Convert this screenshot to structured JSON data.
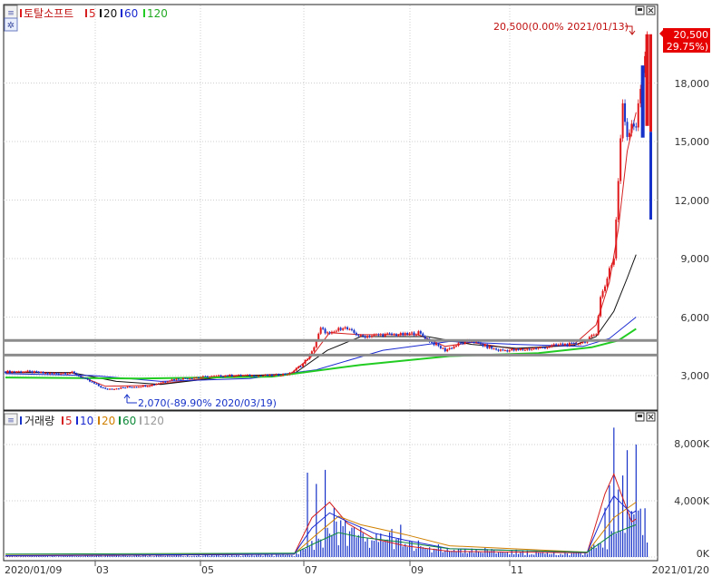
{
  "colors": {
    "up": "#e0181b",
    "down": "#1632c8",
    "ma5": "#d42020",
    "ma20": "#111111",
    "ma60": "#1a2ad0",
    "ma120": "#22cc22",
    "grid": "#cfcfcf",
    "level": "#8c8c8c",
    "vol10": "#1a2ad0",
    "vol20": "#d08000",
    "vol60": "#0f8a3a",
    "vol120": "#aaaaaa",
    "price_box": "#e60000"
  },
  "price_panel": {
    "legend": {
      "name": "토탈소프트",
      "items": [
        {
          "label": "5",
          "color": "#d42020"
        },
        {
          "label": "20",
          "color": "#111111"
        },
        {
          "label": "60",
          "color": "#1a2ad0"
        },
        {
          "label": "120",
          "color": "#22cc22"
        }
      ]
    },
    "high_annotation": "20,500(0.00% 2021/01/13)",
    "low_annotation": "2,070(-89.90% 2020/03/19)",
    "current_price": "20,500",
    "current_change": "( 29.75%)",
    "y_ticks": [
      "18,000",
      "15,000",
      "12,000",
      "9,000",
      "6,000",
      "3,000"
    ]
  },
  "volume_panel": {
    "legend": {
      "name": "거래량",
      "items": [
        {
          "label": "5",
          "color": "#d42020"
        },
        {
          "label": "10",
          "color": "#1a2ad0"
        },
        {
          "label": "20",
          "color": "#d08000"
        },
        {
          "label": "60",
          "color": "#0f8a3a"
        },
        {
          "label": "120",
          "color": "#aaaaaa"
        }
      ]
    },
    "y_ticks": [
      "8,000K",
      "4,000K",
      "0K"
    ]
  },
  "x_axis": {
    "labels": [
      "2020/01/09",
      "03",
      "05",
      "07",
      "09",
      "11",
      "2021/01/20"
    ]
  },
  "chart_data": {
    "type": "candlestick",
    "price_axis": {
      "ticks": [
        3000,
        6000,
        9000,
        12000,
        15000,
        18000
      ],
      "ylim": [
        1500,
        21500
      ]
    },
    "volume_axis": {
      "ticks": [
        0,
        4000,
        8000
      ],
      "unit": "K",
      "ylim": [
        0,
        9500
      ]
    },
    "grid": true,
    "horizontal_levels": [
      4800,
      4050
    ],
    "high": {
      "value": 20500,
      "date": "2021/01/13"
    },
    "low": {
      "value": 2070,
      "date": "2020/03/19"
    },
    "close_series": [
      {
        "day": 0,
        "close": 3200
      },
      {
        "day": 10,
        "close": 3200
      },
      {
        "day": 20,
        "close": 3100
      },
      {
        "day": 30,
        "close": 3150
      },
      {
        "day": 38,
        "close": 2700
      },
      {
        "day": 45,
        "close": 2300
      },
      {
        "day": 55,
        "close": 2400
      },
      {
        "day": 65,
        "close": 2500
      },
      {
        "day": 75,
        "close": 2800
      },
      {
        "day": 85,
        "close": 2900
      },
      {
        "day": 100,
        "close": 3000
      },
      {
        "day": 110,
        "close": 3000
      },
      {
        "day": 120,
        "close": 3000
      },
      {
        "day": 128,
        "close": 3100
      },
      {
        "day": 134,
        "close": 3600
      },
      {
        "day": 138,
        "close": 4200
      },
      {
        "day": 142,
        "close": 5400
      },
      {
        "day": 146,
        "close": 5100
      },
      {
        "day": 152,
        "close": 5500
      },
      {
        "day": 160,
        "close": 5000
      },
      {
        "day": 170,
        "close": 5100
      },
      {
        "day": 180,
        "close": 5100
      },
      {
        "day": 186,
        "close": 5200
      },
      {
        "day": 192,
        "close": 4700
      },
      {
        "day": 198,
        "close": 4300
      },
      {
        "day": 204,
        "close": 4600
      },
      {
        "day": 210,
        "close": 4800
      },
      {
        "day": 216,
        "close": 4500
      },
      {
        "day": 222,
        "close": 4300
      },
      {
        "day": 230,
        "close": 4300
      },
      {
        "day": 240,
        "close": 4400
      },
      {
        "day": 250,
        "close": 4600
      },
      {
        "day": 256,
        "close": 4600
      },
      {
        "day": 262,
        "close": 4800
      },
      {
        "day": 266,
        "close": 5200
      },
      {
        "day": 268,
        "close": 7000
      },
      {
        "day": 270,
        "close": 7600
      },
      {
        "day": 272,
        "close": 8500
      },
      {
        "day": 274,
        "close": 9000
      },
      {
        "day": 276,
        "close": 13000
      },
      {
        "day": 278,
        "close": 17000
      },
      {
        "day": 280,
        "close": 15300
      },
      {
        "day": 282,
        "close": 16000
      },
      {
        "day": 284,
        "close": 15800
      },
      {
        "day": 289,
        "close": 20500
      }
    ],
    "moving_averages": [
      {
        "name": "5",
        "points": [
          {
            "day": 0,
            "value": 3200
          },
          {
            "day": 30,
            "value": 3150
          },
          {
            "day": 45,
            "value": 2450
          },
          {
            "day": 65,
            "value": 2500
          },
          {
            "day": 100,
            "value": 3000
          },
          {
            "day": 128,
            "value": 3050
          },
          {
            "day": 138,
            "value": 4000
          },
          {
            "day": 146,
            "value": 5200
          },
          {
            "day": 160,
            "value": 5100
          },
          {
            "day": 186,
            "value": 5100
          },
          {
            "day": 198,
            "value": 4500
          },
          {
            "day": 210,
            "value": 4700
          },
          {
            "day": 230,
            "value": 4350
          },
          {
            "day": 256,
            "value": 4600
          },
          {
            "day": 266,
            "value": 5600
          },
          {
            "day": 272,
            "value": 7800
          },
          {
            "day": 276,
            "value": 10500
          },
          {
            "day": 280,
            "value": 14500
          },
          {
            "day": 284,
            "value": 16500
          }
        ]
      },
      {
        "name": "20",
        "points": [
          {
            "day": 0,
            "value": 3150
          },
          {
            "day": 30,
            "value": 3150
          },
          {
            "day": 50,
            "value": 2700
          },
          {
            "day": 70,
            "value": 2550
          },
          {
            "day": 100,
            "value": 2950
          },
          {
            "day": 130,
            "value": 3100
          },
          {
            "day": 145,
            "value": 4300
          },
          {
            "day": 160,
            "value": 5000
          },
          {
            "day": 190,
            "value": 5000
          },
          {
            "day": 210,
            "value": 4600
          },
          {
            "day": 230,
            "value": 4400
          },
          {
            "day": 256,
            "value": 4550
          },
          {
            "day": 266,
            "value": 5000
          },
          {
            "day": 274,
            "value": 6300
          },
          {
            "day": 280,
            "value": 8000
          },
          {
            "day": 284,
            "value": 9200
          }
        ]
      },
      {
        "name": "60",
        "points": [
          {
            "day": 0,
            "value": 3100
          },
          {
            "day": 40,
            "value": 3000
          },
          {
            "day": 70,
            "value": 2700
          },
          {
            "day": 110,
            "value": 2850
          },
          {
            "day": 140,
            "value": 3300
          },
          {
            "day": 170,
            "value": 4300
          },
          {
            "day": 200,
            "value": 4750
          },
          {
            "day": 230,
            "value": 4600
          },
          {
            "day": 260,
            "value": 4500
          },
          {
            "day": 272,
            "value": 4900
          },
          {
            "day": 284,
            "value": 6000
          }
        ]
      },
      {
        "name": "120",
        "points": [
          {
            "day": 0,
            "value": 2900
          },
          {
            "day": 60,
            "value": 2850
          },
          {
            "day": 120,
            "value": 2950
          },
          {
            "day": 160,
            "value": 3550
          },
          {
            "day": 200,
            "value": 4000
          },
          {
            "day": 240,
            "value": 4150
          },
          {
            "day": 264,
            "value": 4450
          },
          {
            "day": 276,
            "value": 4800
          },
          {
            "day": 284,
            "value": 5400
          }
        ]
      }
    ],
    "volume_spikes": [
      {
        "day": 136,
        "value": 6000
      },
      {
        "day": 140,
        "value": 5200
      },
      {
        "day": 144,
        "value": 6200
      },
      {
        "day": 148,
        "value": 3500
      },
      {
        "day": 152,
        "value": 2200
      },
      {
        "day": 174,
        "value": 2000
      },
      {
        "day": 178,
        "value": 2300
      },
      {
        "day": 270,
        "value": 3500
      },
      {
        "day": 272,
        "value": 5100
      },
      {
        "day": 274,
        "value": 9200
      },
      {
        "day": 276,
        "value": 4800
      },
      {
        "day": 278,
        "value": 5800
      },
      {
        "day": 280,
        "value": 7600
      },
      {
        "day": 284,
        "value": 8000
      }
    ],
    "volume_ma5": [
      {
        "day": 0,
        "value": 80
      },
      {
        "day": 130,
        "value": 200
      },
      {
        "day": 138,
        "value": 2800
      },
      {
        "day": 146,
        "value": 3900
      },
      {
        "day": 154,
        "value": 2400
      },
      {
        "day": 166,
        "value": 1300
      },
      {
        "day": 180,
        "value": 800
      },
      {
        "day": 200,
        "value": 400
      },
      {
        "day": 262,
        "value": 300
      },
      {
        "day": 270,
        "value": 4500
      },
      {
        "day": 274,
        "value": 5900
      },
      {
        "day": 278,
        "value": 4200
      },
      {
        "day": 282,
        "value": 2500
      },
      {
        "day": 284,
        "value": 2700
      }
    ],
    "volume_ma20": [
      {
        "day": 0,
        "value": 120
      },
      {
        "day": 130,
        "value": 220
      },
      {
        "day": 140,
        "value": 1600
      },
      {
        "day": 150,
        "value": 2900
      },
      {
        "day": 160,
        "value": 2300
      },
      {
        "day": 180,
        "value": 1600
      },
      {
        "day": 200,
        "value": 800
      },
      {
        "day": 262,
        "value": 350
      },
      {
        "day": 274,
        "value": 2800
      },
      {
        "day": 284,
        "value": 3900
      }
    ]
  }
}
